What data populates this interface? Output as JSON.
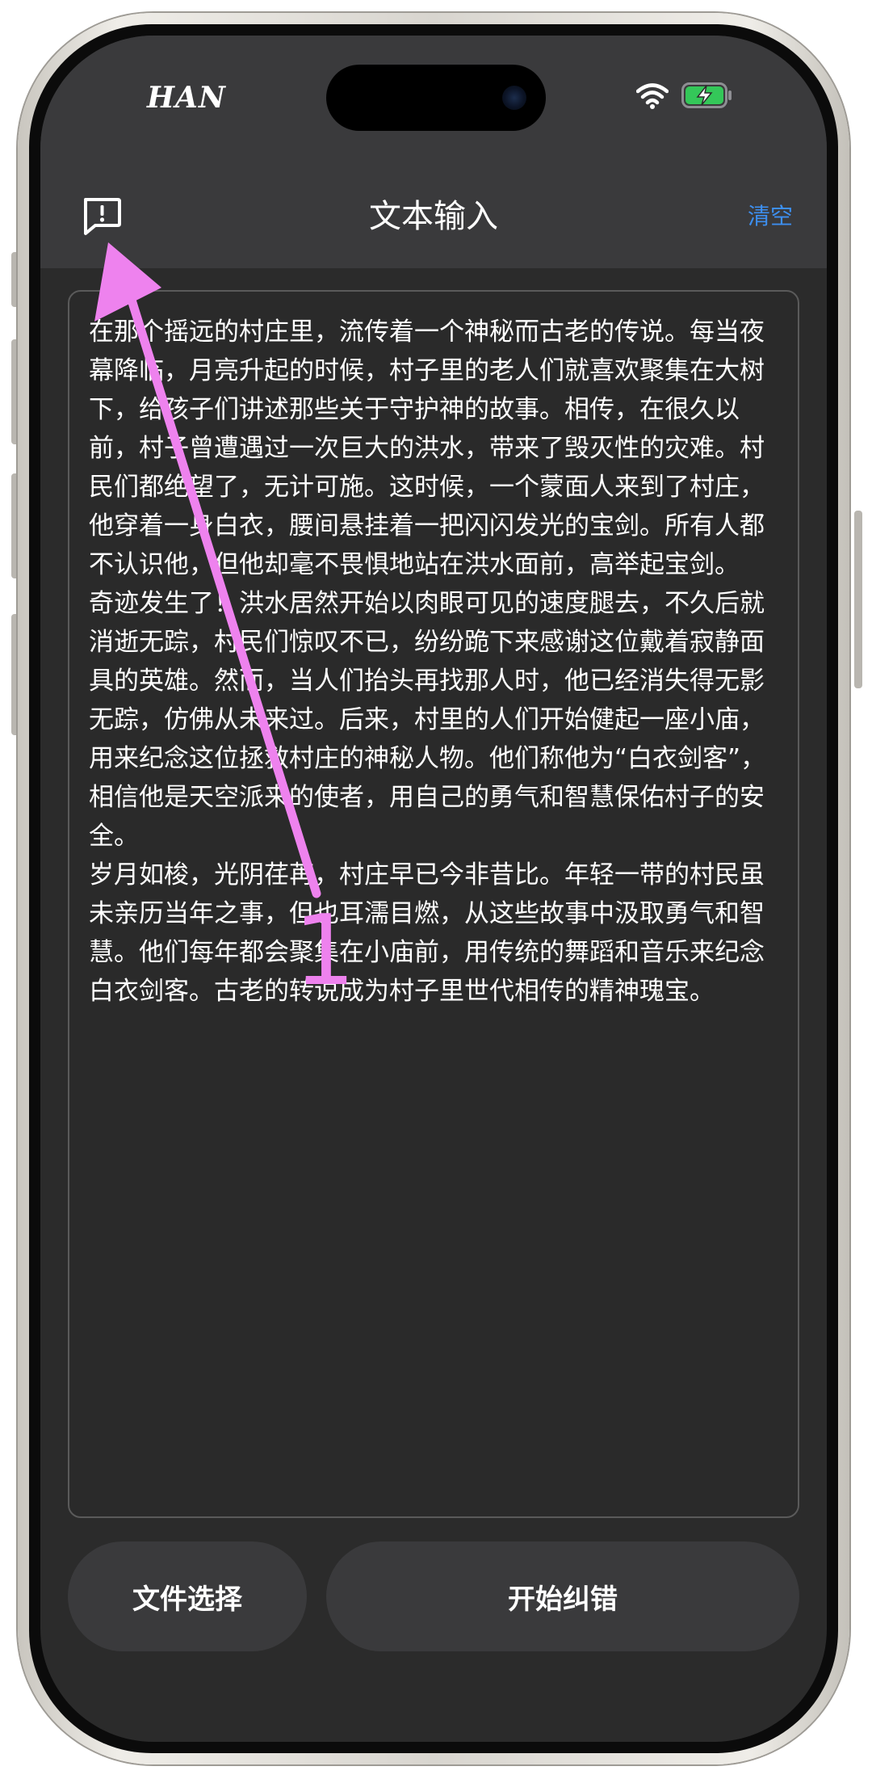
{
  "status_bar": {
    "carrier": "HAN",
    "icons": [
      "wifi-icon",
      "battery-charging-icon"
    ],
    "battery_color": "#34c759"
  },
  "header": {
    "report_icon": "message-alert-icon",
    "title": "文本输入",
    "clear_label": "清空",
    "accent_color": "#3d8ff0"
  },
  "editor": {
    "text": "在那个摇远的村庄里，流传着一个神秘而古老的传说。每当夜幕降临，月亮升起的时候，村子里的老人们就喜欢聚集在大树下，给孩子们讲述那些关于守护神的故事。相传，在很久以前，村子曾遭遇过一次巨大的洪水，带来了毁灭性的灾难。村民们都绝望了，无计可施。这时候，一个蒙面人来到了村庄，他穿着一身白衣，腰间悬挂着一把闪闪发光的宝剑。所有人都不认识他，但他却毫不畏惧地站在洪水面前，高举起宝剑。\n奇迹发生了！洪水居然开始以肉眼可见的速度腿去，不久后就消逝无踪，村民们惊叹不已，纷纷跪下来感谢这位戴着寂静面具的英雄。然而，当人们抬头再找那人时，他已经消失得无影无踪，仿佛从未来过。后来，村里的人们开始健起一座小庙，用来纪念这位拯救村庄的神秘人物。他们称他为“白衣剑客”，相信他是天空派来的使者，用自己的勇气和智慧保佑村子的安全。\n岁月如梭，光阴荏苒，村庄早已今非昔比。年轻一带的村民虽未亲历当年之事，但也耳濡目燃，从这些故事中汲取勇气和智慧。他们每年都会聚集在小庙前，用传统的舞蹈和音乐来纪念白衣剑客。古老的转说成为村子里世代相传的精神瑰宝。"
  },
  "actions": {
    "file_select_label": "文件选择",
    "start_correct_label": "开始纠错"
  },
  "annotation": {
    "step_label": "1",
    "color": "#ee82ee"
  }
}
